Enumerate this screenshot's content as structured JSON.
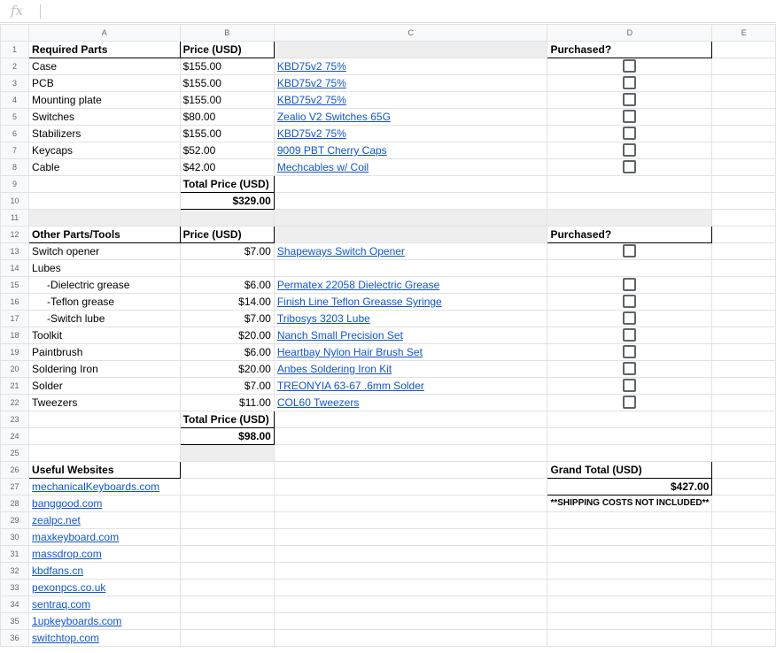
{
  "formula_bar": {
    "fx_label": "fx",
    "content": ""
  },
  "columns": [
    "A",
    "B",
    "C",
    "D",
    "E"
  ],
  "rows": [
    {
      "n": "1",
      "a": "Required Parts",
      "b": "Price (USD)",
      "c": "",
      "d": "Purchased?"
    },
    {
      "n": "2",
      "a": "Case",
      "b": "$155.00",
      "c": "KBD75v2 75%",
      "cb": true
    },
    {
      "n": "3",
      "a": "PCB",
      "b": "$155.00",
      "c": "KBD75v2 75%",
      "cb": true
    },
    {
      "n": "4",
      "a": "Mounting plate",
      "b": "$155.00",
      "c": "KBD75v2 75%",
      "cb": true
    },
    {
      "n": "5",
      "a": "Switches",
      "b": "$80.00",
      "c": "Zealio V2 Switches 65G",
      "cb": true
    },
    {
      "n": "6",
      "a": "Stabilizers",
      "b": "$155.00",
      "c": "KBD75v2 75%",
      "cb": true
    },
    {
      "n": "7",
      "a": "Keycaps",
      "b": "$52.00",
      "c": "9009 PBT Cherry Caps",
      "cb": true
    },
    {
      "n": "8",
      "a": "Cable",
      "b": "$42.00",
      "c": "Mechcables w/ Coil",
      "cb": true
    },
    {
      "n": "9",
      "a": "",
      "b": "Total Price (USD)"
    },
    {
      "n": "10",
      "a": "",
      "b": "$329.00"
    },
    {
      "n": "11"
    },
    {
      "n": "12",
      "a": "Other Parts/Tools",
      "b": "Price (USD)",
      "d": "Purchased?"
    },
    {
      "n": "13",
      "a": "Switch opener",
      "b": "$7.00",
      "c": "Shapeways Switch Opener",
      "cb": true
    },
    {
      "n": "14",
      "a": "Lubes"
    },
    {
      "n": "15",
      "a": "-Dielectric grease",
      "b": "$6.00",
      "c": "Permatex 22058 Dielectric Grease",
      "cb": true
    },
    {
      "n": "16",
      "a": "-Teflon grease",
      "b": "$14.00",
      "c": "Finish Line Teflon Greasse Syringe",
      "cb": true
    },
    {
      "n": "17",
      "a": "-Switch lube",
      "b": "$7.00",
      "c": "Tribosys 3203 Lube",
      "cb": true
    },
    {
      "n": "18",
      "a": "Toolkit",
      "b": "$20.00",
      "c": "Nanch Small Precision Set",
      "cb": true
    },
    {
      "n": "19",
      "a": "Paintbrush",
      "b": "$6.00",
      "c": "Heartbay Nylon Hair Brush Set",
      "cb": true
    },
    {
      "n": "20",
      "a": "Soldering Iron",
      "b": "$20.00",
      "c": "Anbes Soldering Iron Kit",
      "cb": true
    },
    {
      "n": "21",
      "a": "Solder",
      "b": "$7.00",
      "c": "TREONYIA 63-67 .6mm Solder",
      "cb": true
    },
    {
      "n": "22",
      "a": "Tweezers",
      "b": "$11.00",
      "c": "COL60 Tweezers",
      "cb": true
    },
    {
      "n": "23",
      "b": "Total Price (USD)"
    },
    {
      "n": "24",
      "b": "$98.00"
    },
    {
      "n": "25"
    },
    {
      "n": "26",
      "a": "Useful Websites",
      "d": "Grand Total (USD)"
    },
    {
      "n": "27",
      "a": "mechanicalKeyboards.com",
      "d": "$427.00"
    },
    {
      "n": "28",
      "a": "banggood.com",
      "d": "**SHIPPING COSTS NOT INCLUDED**"
    },
    {
      "n": "29",
      "a": "zealpc.net"
    },
    {
      "n": "30",
      "a": "maxkeyboard.com"
    },
    {
      "n": "31",
      "a": "massdrop.com"
    },
    {
      "n": "32",
      "a": "kbdfans.cn"
    },
    {
      "n": "33",
      "a": "pexonpcs.co.uk"
    },
    {
      "n": "34",
      "a": "sentraq.com"
    },
    {
      "n": "35",
      "a": "1upkeyboards.com"
    },
    {
      "n": "36",
      "a": "switchtop.com"
    }
  ]
}
